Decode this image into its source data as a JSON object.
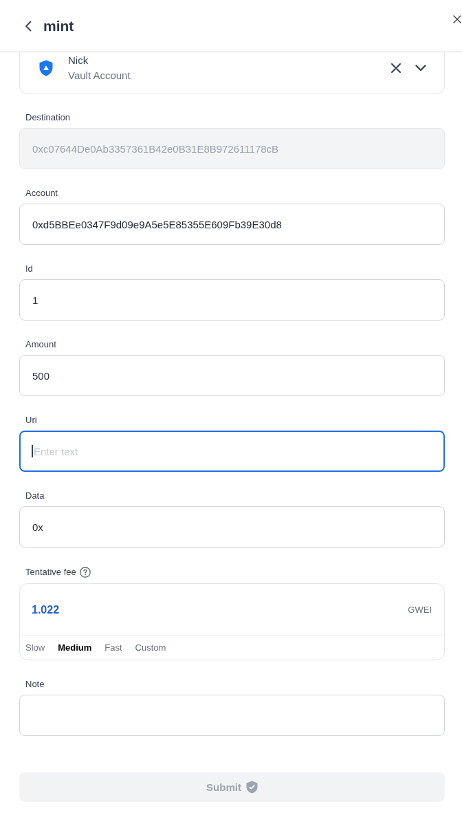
{
  "header": {
    "title": "mint"
  },
  "account": {
    "name": "Nick",
    "type": "Vault Account"
  },
  "form": [
    {
      "kind": "input",
      "label": "Destination",
      "value": "0xc07644De0Ab3357361B42e0B31E8B972611178cB",
      "disabled": true,
      "focused": false
    },
    {
      "kind": "input",
      "label": "Account",
      "value": "0xd5BBEe0347F9d09e9A5e5E85355E609Fb39E30d8",
      "disabled": false,
      "focused": false
    },
    {
      "kind": "input",
      "label": "Id",
      "value": "1",
      "disabled": false,
      "focused": false
    },
    {
      "kind": "input",
      "label": "Amount",
      "value": "500",
      "disabled": false,
      "focused": false
    },
    {
      "kind": "input",
      "label": "Uri",
      "placeholder": "Enter text",
      "disabled": false,
      "focused": true
    },
    {
      "kind": "input",
      "label": "Data",
      "value": "0x",
      "disabled": false,
      "focused": false
    },
    {
      "kind": "fee",
      "label": "Tentative fee",
      "value": "1.022",
      "unit": "GWEI",
      "speeds": [
        {
          "label": "Slow",
          "selected": false
        },
        {
          "label": "Medium",
          "selected": true
        },
        {
          "label": "Fast",
          "selected": false
        },
        {
          "label": "Custom",
          "selected": false
        }
      ]
    },
    {
      "kind": "input",
      "label": "Note",
      "disabled": false,
      "focused": false
    }
  ],
  "submit": {
    "label": "Submit",
    "disabled": true
  }
}
